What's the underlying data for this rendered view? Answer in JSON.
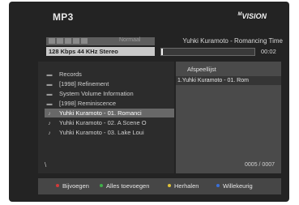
{
  "header": {
    "title": "MP3",
    "brand": "VISION",
    "brand_prefix": "M"
  },
  "controls": {
    "mode": "Normaal",
    "stream_info": "128 Kbps  44 KHz  Stereo"
  },
  "now_playing": {
    "track": "Yuhki Kuramoto - Romancing Time",
    "progress": 0.02,
    "time": "00:02"
  },
  "browser": {
    "items": [
      {
        "label": "Records",
        "icon": "folder-icon"
      },
      {
        "label": "[1998] Refinement",
        "icon": "folder-icon"
      },
      {
        "label": "System Volume Information",
        "icon": "folder-icon"
      },
      {
        "label": "[1998] Reminiscence",
        "icon": "folder-icon"
      },
      {
        "label": "Yuhki Kuramoto - 01. Romanci",
        "icon": "music-file-icon",
        "selected": true
      },
      {
        "label": "Yuhki Kuramoto - 02. A Scene O",
        "icon": "music-file-icon"
      },
      {
        "label": "Yuhki Kuramoto - 03. Lake Loui",
        "icon": "music-file-icon"
      }
    ],
    "path": "\\"
  },
  "playlist": {
    "title": "Afspeellijst",
    "items": [
      "1.Yuhki Kuramoto - 01. Rom"
    ],
    "count": "0005 / 0007"
  },
  "footer": {
    "legend": [
      {
        "label": "Bijvoegen",
        "color": "#d23a3a"
      },
      {
        "label": "Alles toevoegen",
        "color": "#3fb04a"
      },
      {
        "label": "Herhalen",
        "color": "#e0c23a"
      },
      {
        "label": "Willekeurig",
        "color": "#3a6fd8"
      }
    ]
  }
}
